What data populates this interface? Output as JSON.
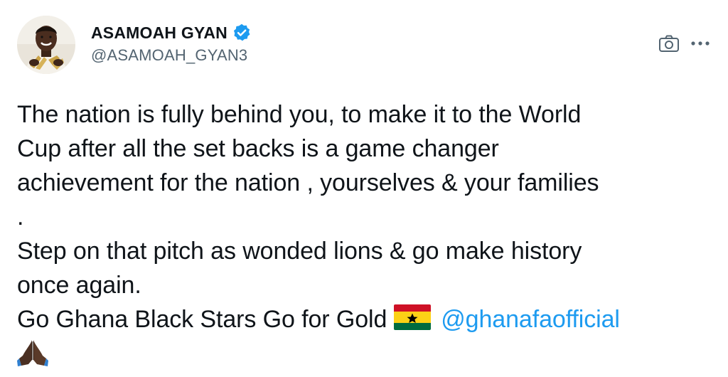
{
  "author": {
    "display_name": "ASAMOAH GYAN",
    "handle": "@ASAMOAH_GYAN3",
    "verified": true
  },
  "actions": {
    "camera_icon": "camera-icon",
    "more_icon": "more-horizontal-icon"
  },
  "tweet": {
    "lines": [
      "The nation is fully behind you, to make it to the World",
      "Cup after all the set backs is a game changer",
      "achievement for the nation , yourselves & your families",
      ".",
      "Step on that pitch as wonded lions & go make history",
      "once again."
    ],
    "last_line_text": "Go Ghana Black Stars Go for Gold",
    "flag_emoji": "ghana-flag-emoji",
    "mention": "@ghanafaofficial",
    "closing_emoji": "folded-hands-emoji"
  },
  "colors": {
    "text": "#0f1419",
    "secondary": "#536471",
    "accent": "#1d9bf0"
  }
}
